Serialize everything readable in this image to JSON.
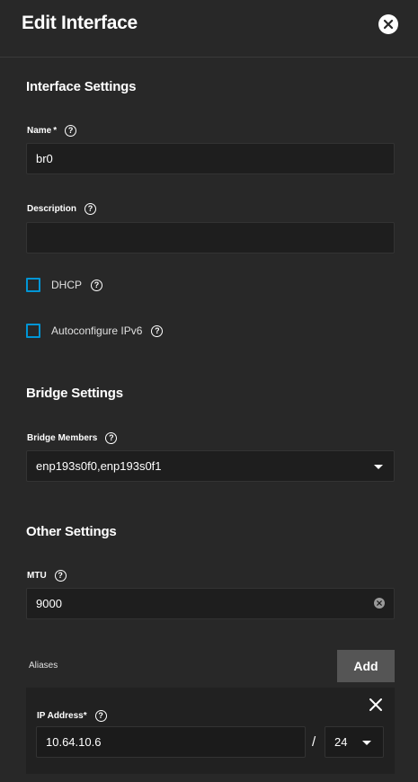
{
  "header": {
    "title": "Edit Interface",
    "close_icon": "close-circle-icon"
  },
  "interface_settings": {
    "title": "Interface Settings",
    "name": {
      "label": "Name",
      "required_mark": "*",
      "value": "br0"
    },
    "description": {
      "label": "Description",
      "value": ""
    },
    "dhcp": {
      "label": "DHCP",
      "checked": false
    },
    "autoconfigure_ipv6": {
      "label": "Autoconfigure IPv6",
      "checked": false
    }
  },
  "bridge_settings": {
    "title": "Bridge Settings",
    "bridge_members": {
      "label": "Bridge Members",
      "value": "enp193s0f0,enp193s0f1"
    }
  },
  "other_settings": {
    "title": "Other Settings",
    "mtu": {
      "label": "MTU",
      "value": "9000"
    }
  },
  "aliases": {
    "label": "Aliases",
    "add_label": "Add",
    "items": [
      {
        "ip_label": "IP Address",
        "required_mark": "*",
        "ip_value": "10.64.10.6",
        "separator": "/",
        "netmask": "24"
      }
    ]
  },
  "colors": {
    "background": "#282828",
    "input_bg": "#1e1e1e",
    "checkbox_accent": "#0095d5",
    "button_bg": "#555555"
  }
}
